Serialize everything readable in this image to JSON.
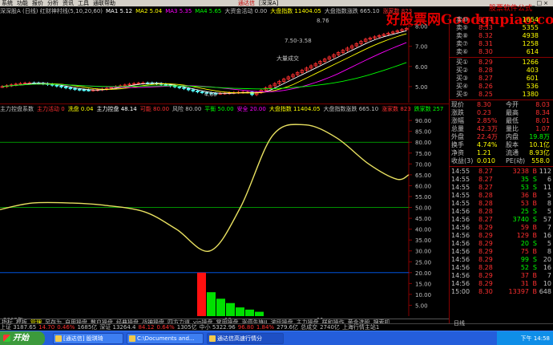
{
  "menubar": {
    "items": [
      "系统",
      "功能",
      "报价",
      "分析",
      "资讯",
      "工具",
      "通联帮助"
    ],
    "app_title": "通达信",
    "market": "[深深A]",
    "window_controls": [
      "_",
      "□",
      "×"
    ]
  },
  "watermark": {
    "main": "好股票网Goodgupiao.com",
    "top": "股票软件公式"
  },
  "price_header": {
    "items": [
      {
        "text": "深深股A (日线) 红财神村线(5,10,20,60)",
        "color": "#c0c0c0"
      },
      {
        "text": "MA1 5.12",
        "color": "#ffffff"
      },
      {
        "text": "MA2 5.04",
        "color": "#ffff00"
      },
      {
        "text": "MA3 5.35",
        "color": "#ff00ff"
      },
      {
        "text": "MA4 5.65",
        "color": "#00ff00"
      },
      {
        "text": "大资金活动 0.00",
        "color": "#c0c0c0"
      },
      {
        "text": "大盘指数 11404.05",
        "color": "#ffff00"
      },
      {
        "text": "大盘指数涨跌 665.10",
        "color": "#c0c0c0"
      },
      {
        "text": "涨家数 823",
        "color": "#ff3030"
      }
    ]
  },
  "price_chart": {
    "y_ticks": [
      "8.00",
      "7.00",
      "6.00",
      "5.00"
    ],
    "annotations": [
      "7.50-3.58",
      "大量成交",
      "4.60",
      "8.76"
    ],
    "ma_colors": {
      "ma1": "#ffffff",
      "ma2": "#ffff00",
      "ma3": "#ff00ff",
      "ma4": "#00ff00"
    }
  },
  "ind_header": {
    "items": [
      {
        "text": "主力控盘系数",
        "color": "#c0c0c0"
      },
      {
        "text": "主力活动 0",
        "color": "#ff3030"
      },
      {
        "text": "洗盘 0.04",
        "color": "#ffff00"
      },
      {
        "text": "主力控盘 48.14",
        "color": "#ffffff"
      },
      {
        "text": "可能 80.00",
        "color": "#ff3030"
      },
      {
        "text": "风险 80.00",
        "color": "#c0c0c0"
      },
      {
        "text": "平衡 50.00",
        "color": "#00ff00"
      },
      {
        "text": "安全 20.00",
        "color": "#ff00ff"
      },
      {
        "text": "大盘指数 11404.05",
        "color": "#ffff00"
      },
      {
        "text": "大盘指数涨跌 665.10",
        "color": "#c0c0c0"
      },
      {
        "text": "涨家数 823",
        "color": "#ff3030"
      },
      {
        "text": "跌家数 257",
        "color": "#00ff00"
      }
    ]
  },
  "ind_chart": {
    "y_ticks": [
      "90.00",
      "85.00",
      "80.00",
      "75.00",
      "70.00",
      "65.00",
      "60.00",
      "55.00",
      "50.00",
      "45.00",
      "40.00",
      "35.00",
      "30.00",
      "25.00",
      "20.00",
      "15.00",
      "10.00",
      "5.00"
    ],
    "date_labels": [
      "2009年",
      "10",
      "11"
    ],
    "line_color": "#e8e060",
    "bars_red": [
      20
    ],
    "bars_green": [
      11,
      8,
      6,
      4,
      3,
      2
    ]
  },
  "order_book": {
    "sell": [
      {
        "label": "卖⑩",
        "price": "8.34",
        "vol": "1654"
      },
      {
        "label": "卖⑨",
        "price": "8.33",
        "vol": "5355"
      },
      {
        "label": "卖⑧",
        "price": "8.32",
        "vol": "4938"
      },
      {
        "label": "卖⑦",
        "price": "8.31",
        "vol": "1258"
      },
      {
        "label": "卖⑥",
        "price": "8.30",
        "vol": "614"
      }
    ],
    "buy": [
      {
        "label": "买①",
        "price": "8.29",
        "vol": "1266"
      },
      {
        "label": "买②",
        "price": "8.28",
        "vol": "403"
      },
      {
        "label": "买③",
        "price": "8.27",
        "vol": "601"
      },
      {
        "label": "买④",
        "price": "8.26",
        "vol": "536"
      },
      {
        "label": "买⑤",
        "price": "8.25",
        "vol": "1380"
      }
    ]
  },
  "stats": [
    {
      "k1": "现价",
      "v1": "8.30",
      "k2": "今开",
      "v2": "8.03"
    },
    {
      "k1": "涨跌",
      "v1": "0.23",
      "k2": "最高",
      "v2": "8.34"
    },
    {
      "k1": "涨幅",
      "v1": "2.85%",
      "k2": "最低",
      "v2": "8.01"
    },
    {
      "k1": "总量",
      "v1": "42.3万",
      "k2": "量比",
      "v2": "1.07"
    },
    {
      "k1": "外盘",
      "v1": "22.4万",
      "k2": "内盘",
      "v2": "19.8万"
    },
    {
      "k1": "换手",
      "v1": "4.74%",
      "k2": "股本",
      "v2": "10.1亿"
    },
    {
      "k1": "净资",
      "v1": "1.21",
      "k2": "流通",
      "v2": "8.93亿"
    },
    {
      "k1": "收益(3)",
      "v1": "0.010",
      "k2": "PE(动)",
      "v2": "558.0"
    }
  ],
  "trades": [
    {
      "time": "14:55",
      "price": "8.27",
      "vol": "3238",
      "side": "B",
      "n": "112"
    },
    {
      "time": "14:55",
      "price": "8.27",
      "vol": "35",
      "side": "S",
      "n": "6"
    },
    {
      "time": "14:55",
      "price": "8.27",
      "vol": "53",
      "side": "S",
      "n": "11"
    },
    {
      "time": "14:55",
      "price": "8.28",
      "vol": "36",
      "side": "B",
      "n": "5"
    },
    {
      "time": "14:55",
      "price": "8.28",
      "vol": "53",
      "side": "B",
      "n": "8"
    },
    {
      "time": "14:56",
      "price": "8.28",
      "vol": "25",
      "side": "S",
      "n": "5"
    },
    {
      "time": "14:56",
      "price": "8.27",
      "vol": "3740",
      "side": "S",
      "n": "57"
    },
    {
      "time": "14:56",
      "price": "8.29",
      "vol": "59",
      "side": "B",
      "n": "7"
    },
    {
      "time": "14:56",
      "price": "8.29",
      "vol": "129",
      "side": "B",
      "n": "16"
    },
    {
      "time": "14:56",
      "price": "8.29",
      "vol": "20",
      "side": "S",
      "n": "5"
    },
    {
      "time": "14:56",
      "price": "8.29",
      "vol": "75",
      "side": "B",
      "n": "8"
    },
    {
      "time": "14:56",
      "price": "8.29",
      "vol": "99",
      "side": "S",
      "n": "20"
    },
    {
      "time": "14:56",
      "price": "8.28",
      "vol": "52",
      "side": "S",
      "n": "16"
    },
    {
      "time": "14:56",
      "price": "8.29",
      "vol": "37",
      "side": "B",
      "n": "7"
    },
    {
      "time": "14:56",
      "price": "8.29",
      "vol": "31",
      "side": "B",
      "n": "10"
    },
    {
      "time": "15:00",
      "price": "8.30",
      "vol": "13397",
      "side": "B",
      "n": "648"
    }
  ],
  "tabs": {
    "items": [
      "指标",
      "模板",
      "管理",
      "另存为",
      "自用操盘",
      "散户操盘",
      "经典操盘",
      "战神操盘",
      "四方力道",
      "vip操盘",
      "常用操盘",
      "涨停先锋II",
      "波段操盘",
      "主力操盘",
      "样和操作",
      "黄金选股",
      "搜索机"
    ],
    "active_index": 2,
    "right_label": "日线"
  },
  "ticker": {
    "items": [
      {
        "text": "上证 3187.65",
        "color": "#c0c0c0"
      },
      {
        "text": "14.70",
        "color": "#ff3030"
      },
      {
        "text": "0.46%",
        "color": "#ff3030"
      },
      {
        "text": "1685亿",
        "color": "#c0c0c0"
      },
      {
        "text": "深证 13264.4",
        "color": "#c0c0c0"
      },
      {
        "text": "84.12",
        "color": "#ff3030"
      },
      {
        "text": "0.64%",
        "color": "#ff3030"
      },
      {
        "text": "1305亿",
        "color": "#c0c0c0"
      },
      {
        "text": "中小 5322.96",
        "color": "#c0c0c0"
      },
      {
        "text": "96.80",
        "color": "#ff3030"
      },
      {
        "text": "1.84%",
        "color": "#ff3030"
      },
      {
        "text": "279.6亿",
        "color": "#c0c0c0"
      },
      {
        "text": "总成交",
        "color": "#c0c0c0"
      },
      {
        "text": "2740亿",
        "color": "#c0c0c0"
      },
      {
        "text": "上海行情主站1",
        "color": "#c0c0c0"
      }
    ]
  },
  "taskbar": {
    "start": "开始",
    "tasks": [
      "[通达信] 股琪琦",
      "C:\\Documents and...",
      "通达信高速行情分"
    ],
    "clock": "下午 14:58"
  }
}
